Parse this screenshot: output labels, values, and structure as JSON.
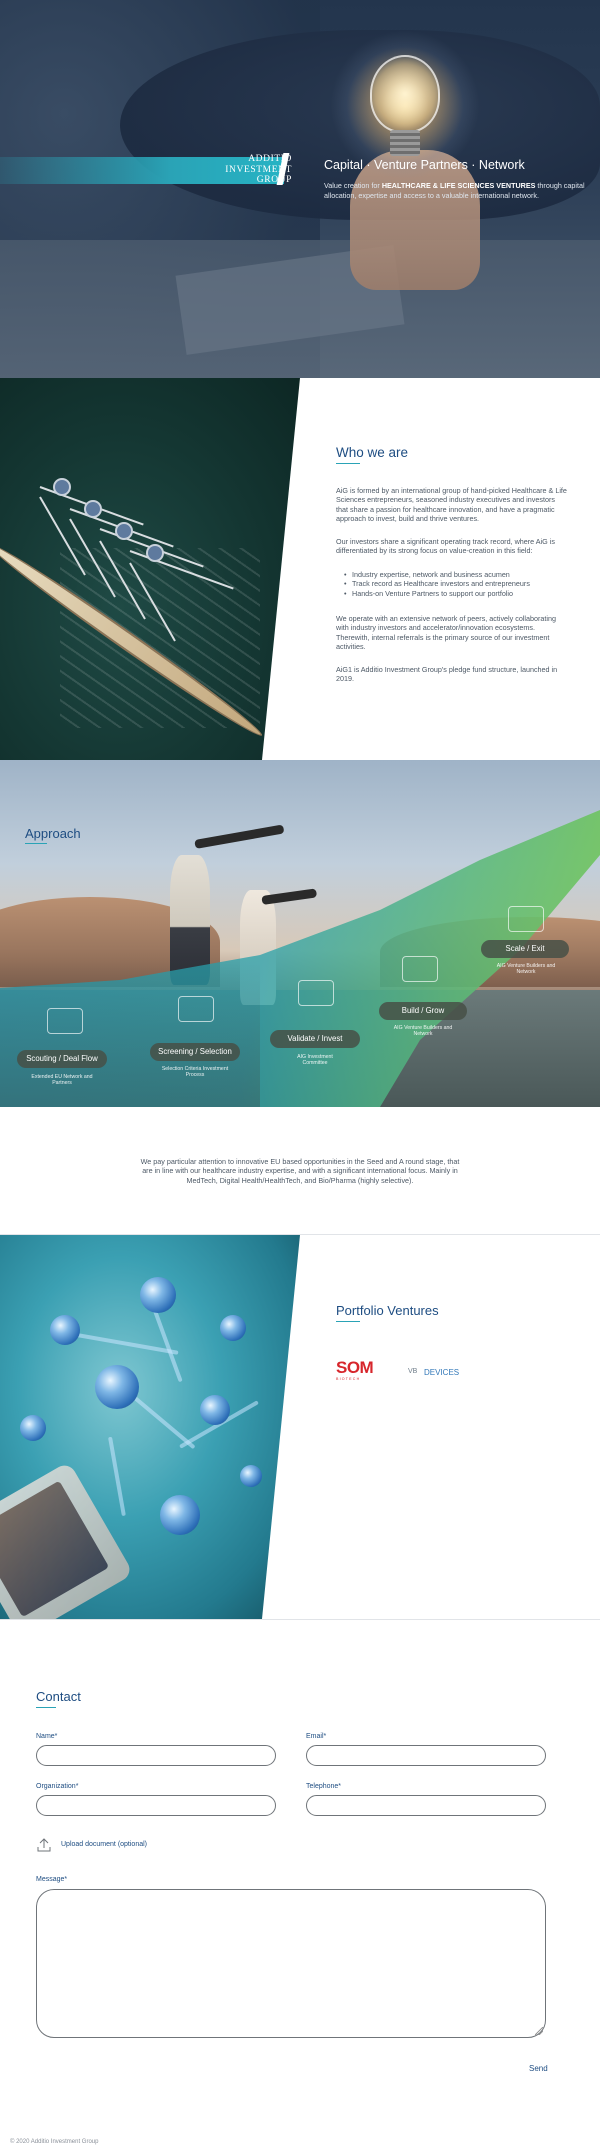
{
  "hero": {
    "logo_lines": [
      "ADDITIO",
      "INVESTMENT",
      "GROUP"
    ],
    "title": "Capital · Venture Partners · Network",
    "subtitle_before": "Value creation for ",
    "subtitle_bold": "HEALTHCARE & LIFE SCIENCES VENTURES",
    "subtitle_after": " through capital allocation, expertise and access to a valuable international network."
  },
  "who": {
    "title": "Who we are",
    "paragraphs": [
      "AiG is formed by an international group of hand-picked Healthcare & Life Sciences entrepreneurs, seasoned industry executives and investors that share a passion for healthcare innovation, and have a pragmatic approach to invest, build and thrive ventures.",
      "Our investors share a significant operating track record, where AiG is differentiated by its strong focus on value-creation in this field:",
      "We operate with an extensive network of peers, actively collaborating with industry investors and accelerator/innovation ecosystems. Therewith, internal referrals is the primary source of our investment activities.",
      "AiG1 is Additio Investment Group's pledge fund structure, launched in 2019."
    ],
    "bullets": [
      "Industry expertise, network and business acumen",
      "Track record as Healthcare investors and entrepreneurs",
      "Hands-on Venture Partners to support our portfolio"
    ]
  },
  "approach": {
    "title": "Approach",
    "stages": [
      {
        "label": "Scouting / Deal Flow",
        "caption": "Extended EU Network and Partners"
      },
      {
        "label": "Screening / Selection",
        "caption": "Selection Criteria Investment Process"
      },
      {
        "label": "Validate / Invest",
        "caption": "AIG Investment Committee"
      },
      {
        "label": "Build / Grow",
        "caption": "AIG Venture Builders and Network"
      },
      {
        "label": "Scale / Exit",
        "caption": "AIG Venture Builders and Network"
      }
    ]
  },
  "info": {
    "text": "We pay particular attention to innovative EU based opportunities in the Seed and A round stage, that are in line with our healthcare industry expertise, and with a significant international focus. Mainly in MedTech, Digital Health/HealthTech, and Bio/Pharma (highly selective)."
  },
  "portfolio": {
    "title": "Portfolio Ventures",
    "logos": [
      {
        "main": "SOM",
        "sub": "BIOTECH",
        "icon": "som-logo"
      },
      {
        "main": "DEVICES",
        "mark": "VB",
        "icon": "vb-devices-logo"
      }
    ]
  },
  "contact": {
    "title": "Contact",
    "name_label": "Name*",
    "email_label": "Email*",
    "organization_label": "Organization*",
    "telephone_label": "Telephone*",
    "upload_label": "Upload document (optional)",
    "message_label": "Message*",
    "send_label": "Send"
  },
  "footer": {
    "text": "© 2020 Additio Investment Group"
  },
  "colors": {
    "accent": "#2aa3b6",
    "heading": "#1e4d82",
    "som_red": "#d7262c"
  }
}
